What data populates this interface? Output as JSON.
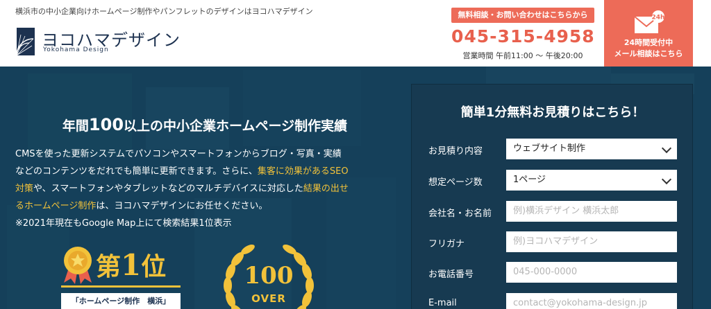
{
  "header": {
    "tagline": "横浜市の中小企業向けホームページ制作やパンフレットのデザインはヨコハマデザイン",
    "logo_text": "ヨコハマデザイン",
    "logo_sub": "Yokohama Design",
    "contact_badge": "無料相談・お問い合わせはこちらから",
    "phone": "045-315-4958",
    "hours": "営業時間 午前11:00 〜 午後20:00",
    "mail_badge": "24h",
    "mail_line1": "24時間受付中",
    "mail_line2": "メール相談はこちら",
    "colors": {
      "accent": "#ed6b58",
      "navy": "#1d3250"
    }
  },
  "hero": {
    "title_pre": "年間",
    "title_num": "100",
    "title_post": "以上の中小企業ホームページ制作実績",
    "text": {
      "l1": "CMSを使った更新システムでパソコンやスマートフォンからブログ・写真・実績",
      "l2a": "などのコンテンツをだれでも簡単に更新できます。さらに、",
      "l2b": "集客に効果があるSEO",
      "l3a": "対策",
      "l3b": "や、スマートフォンやタブレットなどのマルチデバイスに対応した",
      "l3c": "結果の出せ",
      "l4a": "るホームページ制作",
      "l4b": "は、ヨコハマデザインにお任せください。",
      "l5": "※2021年現在もGoogle Map上にて検索結果1位表示"
    },
    "award1": {
      "kanji": "第",
      "num": "1",
      "unit": "位",
      "caption": "「ホームページ制作　横浜」"
    },
    "award2": {
      "num": "100",
      "over": "OVER"
    },
    "colors": {
      "highlight": "#f2c23a",
      "bg": "#1a4660"
    }
  },
  "form": {
    "title": "簡単1分無料お見積りはこちら！",
    "rows": [
      {
        "label": "お見積り内容",
        "value": "ウェブサイト制作"
      },
      {
        "label": "想定ページ数",
        "value": "1ページ"
      },
      {
        "label": "会社名・お名前",
        "placeholder": "例)横浜デザイン 横浜太郎"
      },
      {
        "label": "フリガナ",
        "placeholder": "例)ヨコハマデザイン"
      },
      {
        "label": "お電話番号",
        "placeholder": "045-000-0000"
      },
      {
        "label": "E-mail",
        "placeholder": "contact@yokohama-design.jp"
      }
    ]
  }
}
